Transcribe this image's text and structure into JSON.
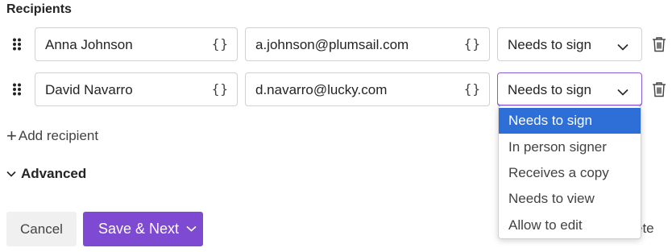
{
  "section_title": "Recipients",
  "recipients": [
    {
      "name": "Anna Johnson",
      "email": "a.johnson@plumsail.com",
      "role": "Needs to sign"
    },
    {
      "name": "David Navarro",
      "email": "d.navarro@lucky.com",
      "role": "Needs to sign"
    }
  ],
  "brace_symbol": "{}",
  "add_recipient_label": "Add recipient",
  "advanced_label": "Advanced",
  "buttons": {
    "cancel": "Cancel",
    "save_next": "Save & Next"
  },
  "obscured_text": "ete",
  "role_options": [
    "Needs to sign",
    "In person signer",
    "Receives a copy",
    "Needs to view",
    "Allow to edit"
  ],
  "selected_role_option": "Needs to sign",
  "colors": {
    "accent": "#7f4ad2",
    "selection": "#2e6fd7",
    "focus_border": "#8a5bd6"
  },
  "icons": [
    "drag-handle-icon",
    "variable-braces-icon",
    "chevron-down-icon",
    "trash-icon",
    "plus-icon",
    "chevron-down-icon"
  ]
}
